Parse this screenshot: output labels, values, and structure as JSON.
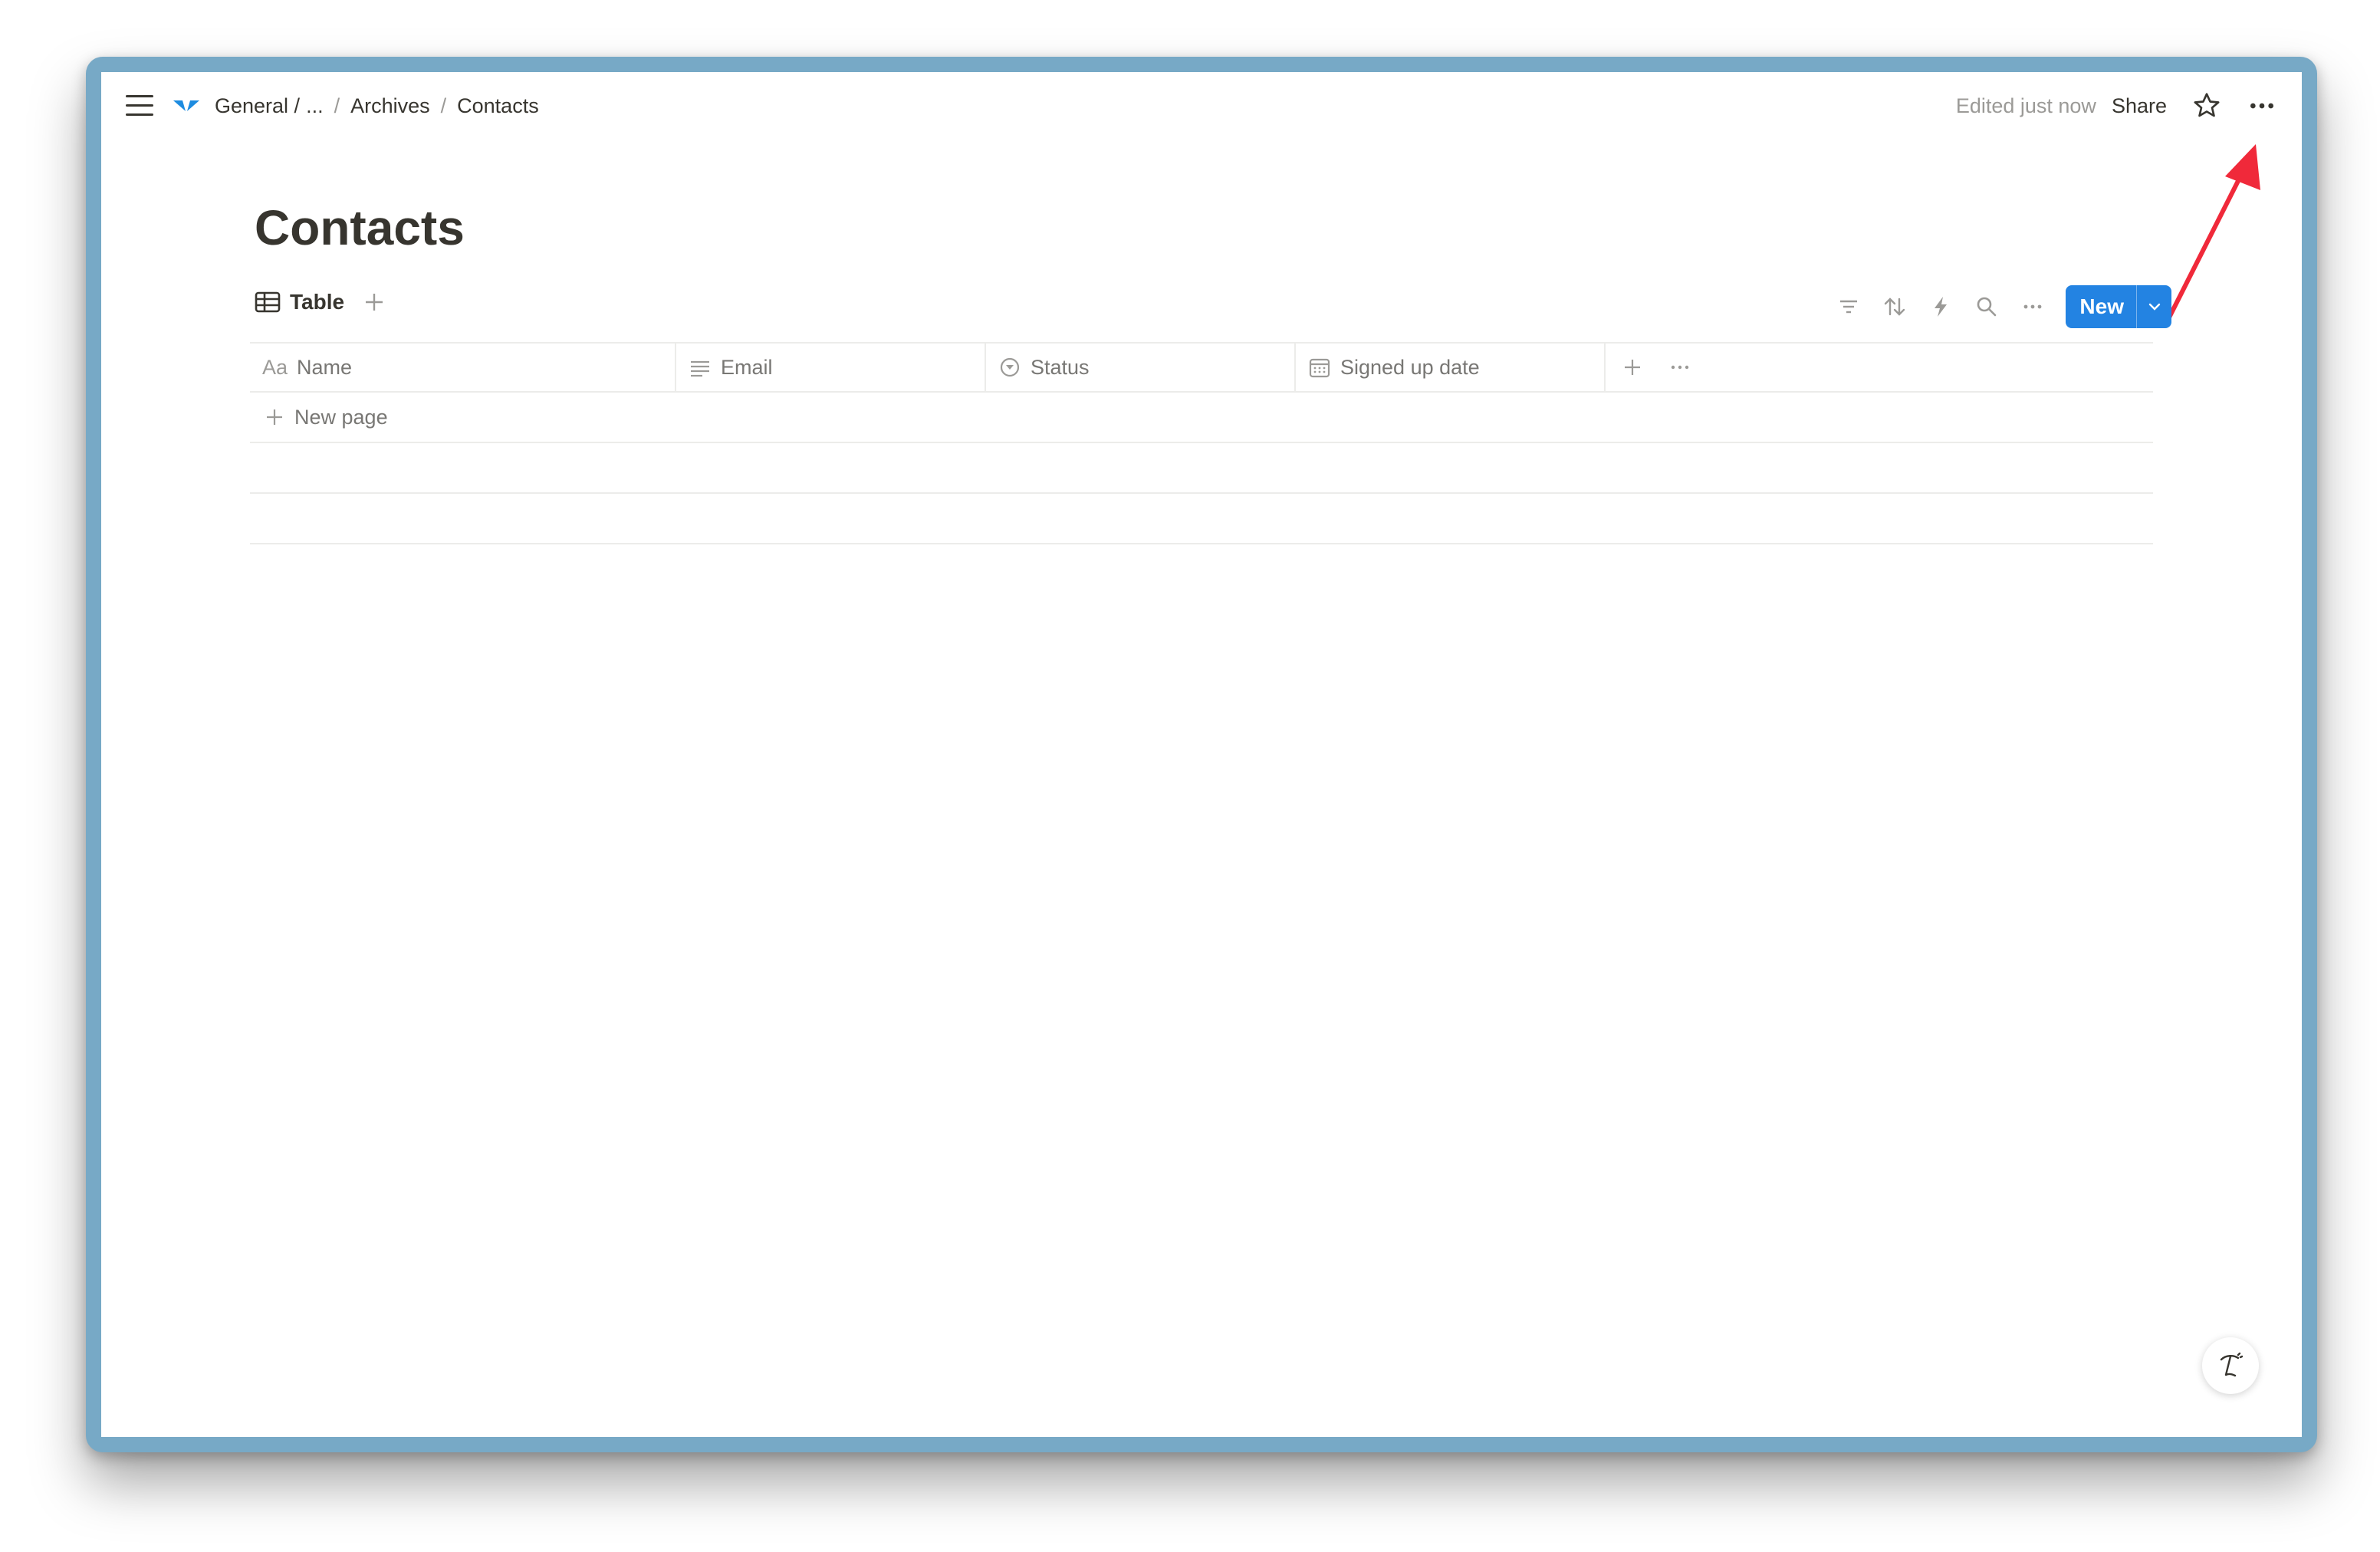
{
  "breadcrumb": {
    "items": [
      "General /",
      "...",
      "Archives",
      "Contacts"
    ],
    "separator": "/"
  },
  "topbar": {
    "edited": "Edited just now",
    "share": "Share"
  },
  "page": {
    "title": "Contacts"
  },
  "views": {
    "active": "Table"
  },
  "toolbar": {
    "new_label": "New"
  },
  "table": {
    "columns": [
      "Name",
      "Email",
      "Status",
      "Signed up date"
    ],
    "name_prefix": "Aa",
    "new_page": "New page"
  },
  "colors": {
    "accent": "#2383e2",
    "frame": "#77a9c6",
    "annotation": "#f0293a"
  }
}
